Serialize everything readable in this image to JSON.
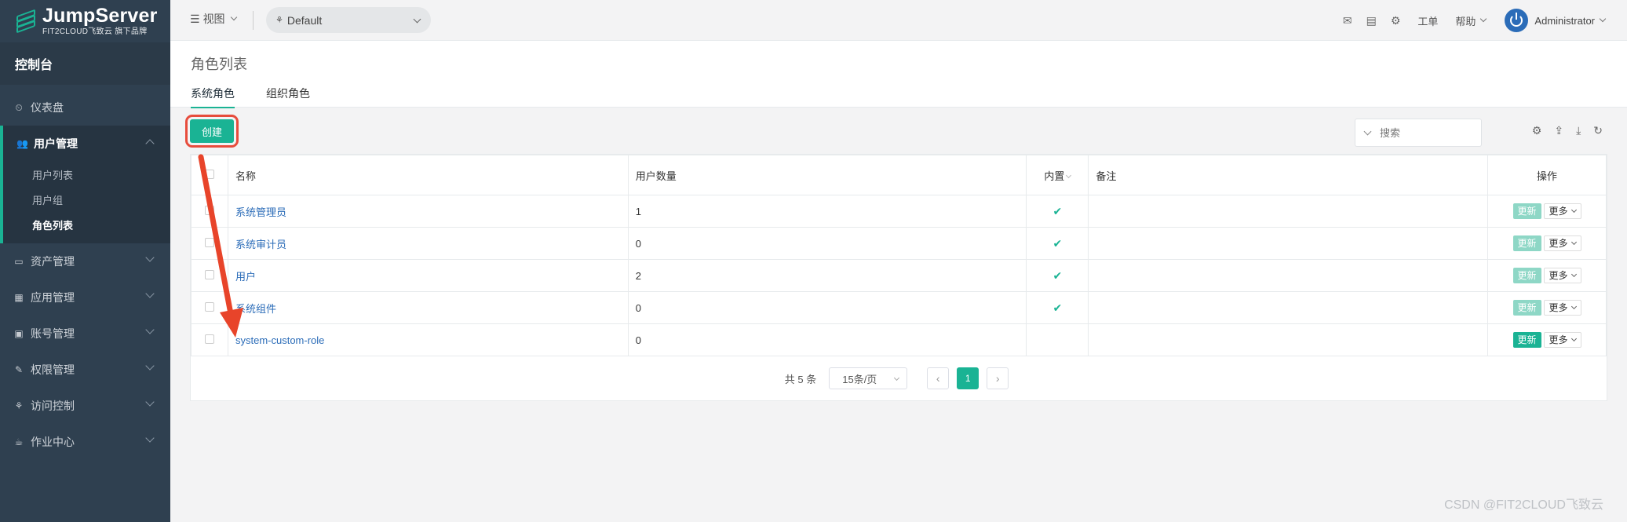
{
  "brand": {
    "title": "JumpServer",
    "subtitle": "FIT2CLOUD飞致云 旗下品牌"
  },
  "sidebar": {
    "console_label": "控制台",
    "items": [
      {
        "label": "仪表盘",
        "icon": "dashboard-icon"
      },
      {
        "label": "用户管理",
        "icon": "users-icon",
        "expanded": true,
        "children": [
          {
            "label": "用户列表"
          },
          {
            "label": "用户组"
          },
          {
            "label": "角色列表",
            "active": true
          }
        ]
      },
      {
        "label": "资产管理",
        "icon": "inbox-icon"
      },
      {
        "label": "应用管理",
        "icon": "grid-icon"
      },
      {
        "label": "账号管理",
        "icon": "account-book-icon"
      },
      {
        "label": "权限管理",
        "icon": "edit-icon"
      },
      {
        "label": "访问控制",
        "icon": "sitemap-icon"
      },
      {
        "label": "作业中心",
        "icon": "coffee-icon"
      }
    ]
  },
  "topbar": {
    "view_label": "视图",
    "org_label": "Default",
    "ticket_label": "工单",
    "help_label": "帮助",
    "user_name": "Administrator"
  },
  "page": {
    "title": "角色列表",
    "tabs": [
      {
        "label": "系统角色",
        "active": true
      },
      {
        "label": "组织角色",
        "active": false
      }
    ]
  },
  "toolbar": {
    "create_label": "创建",
    "search_placeholder": "搜索"
  },
  "table": {
    "columns": {
      "name": "名称",
      "user_count": "用户数量",
      "builtin": "内置",
      "comment": "备注",
      "actions": "操作"
    },
    "update_label": "更新",
    "more_label": "更多",
    "rows": [
      {
        "name": "系统管理员",
        "user_count": "1",
        "builtin": true,
        "comment": "",
        "update_enabled": false
      },
      {
        "name": "系统审计员",
        "user_count": "0",
        "builtin": true,
        "comment": "",
        "update_enabled": false
      },
      {
        "name": "用户",
        "user_count": "2",
        "builtin": true,
        "comment": "",
        "update_enabled": false
      },
      {
        "name": "系统组件",
        "user_count": "0",
        "builtin": true,
        "comment": "",
        "update_enabled": false
      },
      {
        "name": "system-custom-role",
        "user_count": "0",
        "builtin": false,
        "comment": "",
        "update_enabled": true
      }
    ]
  },
  "pagination": {
    "total_label": "共 5 条",
    "page_size_label": "15条/页",
    "current_page": "1"
  },
  "annotation": {
    "arrow_color": "#e8442a"
  },
  "watermark": "CSDN @FIT2CLOUD飞致云"
}
